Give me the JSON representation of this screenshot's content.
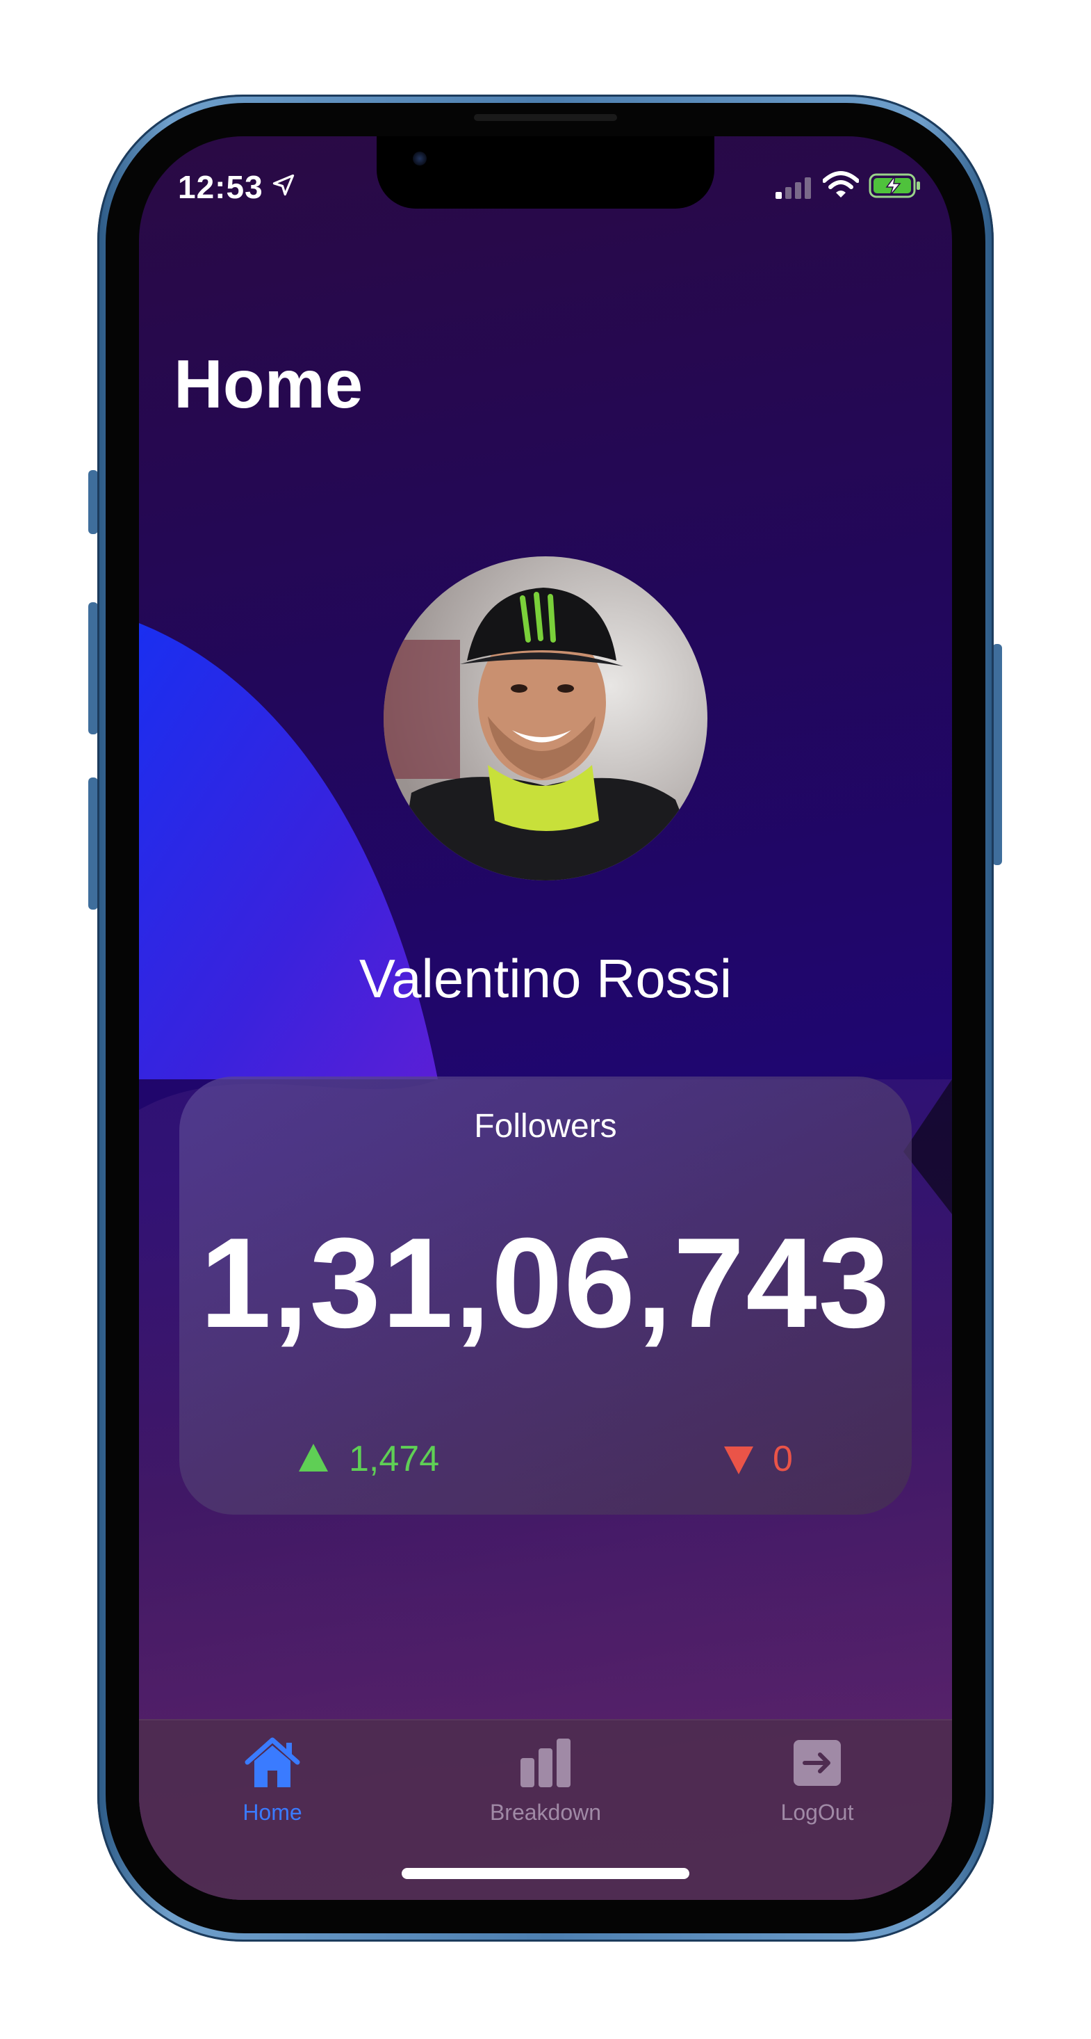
{
  "status_bar": {
    "time": "12:53",
    "location_icon": "location-arrow-icon",
    "signal_icon": "cellular-signal-icon",
    "wifi_icon": "wifi-icon",
    "battery_icon": "battery-charging-icon"
  },
  "page": {
    "title": "Home"
  },
  "profile": {
    "name": "Valentino Rossi",
    "avatar_icon": "profile-photo"
  },
  "followers": {
    "label": "Followers",
    "count": "1,31,06,743",
    "gained": "1,474",
    "lost": "0",
    "gained_color": "#5fcf55",
    "lost_color": "#ea5448"
  },
  "tabs": [
    {
      "label": "Home",
      "icon": "house-icon",
      "active": true,
      "color": "#3a7bff"
    },
    {
      "label": "Breakdown",
      "icon": "bar-chart-icon",
      "active": false,
      "color": "#a08aa6"
    },
    {
      "label": "LogOut",
      "icon": "logout-icon",
      "active": false,
      "color": "#a08aa6"
    }
  ]
}
